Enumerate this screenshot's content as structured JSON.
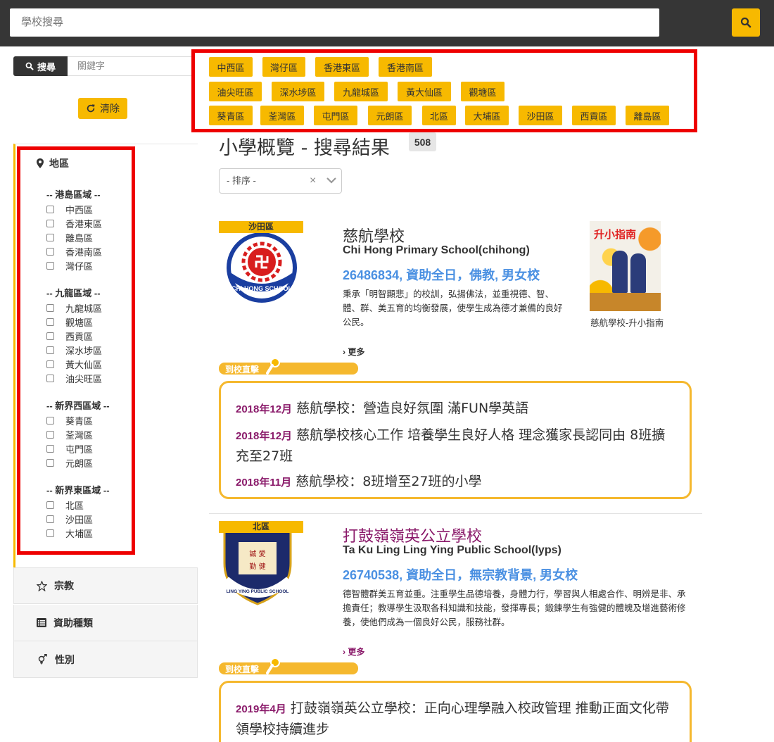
{
  "topbar": {
    "search_placeholder": "學校搜尋",
    "search_button_icon": "search-icon"
  },
  "sidebar": {
    "keyword_button": "搜尋",
    "keyword_placeholder": "關鍵字",
    "clear_button": "清除",
    "region_title": "地區",
    "groups": [
      {
        "title": "-- 港島區域 --",
        "items": [
          "中西區",
          "香港東區",
          "離島區",
          "香港南區",
          "灣仔區"
        ]
      },
      {
        "title": "-- 九龍區域 --",
        "items": [
          "九龍城區",
          "觀塘區",
          "西貢區",
          "深水埗區",
          "黃大仙區",
          "油尖旺區"
        ]
      },
      {
        "title": "-- 新界西區域 --",
        "items": [
          "葵青區",
          "荃灣區",
          "屯門區",
          "元朗區"
        ]
      },
      {
        "title": "-- 新界東區域 --",
        "items": [
          "北區",
          "沙田區",
          "大埔區"
        ]
      }
    ],
    "accordions": [
      {
        "label": "宗教",
        "icon": "star-outline-icon"
      },
      {
        "label": "資助種類",
        "icon": "list-icon"
      },
      {
        "label": "性別",
        "icon": "gender-icon"
      }
    ]
  },
  "district_tags": {
    "row1": [
      "中西區",
      "灣仔區",
      "香港東區",
      "香港南區"
    ],
    "row2": [
      "油尖旺區",
      "深水埗區",
      "九龍城區",
      "黃大仙區",
      "觀塘區"
    ],
    "row3": [
      "葵青區",
      "荃灣區",
      "屯門區",
      "元朗區",
      "北區",
      "大埔區",
      "沙田區",
      "西貢區",
      "離島區"
    ]
  },
  "results": {
    "title": "小學概覽 - 搜尋結果",
    "count": "508",
    "sort_placeholder": "- 排序 -",
    "sort_clear": "×"
  },
  "schools": [
    {
      "district": "沙田區",
      "name_zh": "慈航學校",
      "name_en": "Chi Hong Primary School(chihong)",
      "info": "26486834, 資助全日，佛教, 男女校",
      "description": "秉承「明智顯悲」的校訓，弘揚佛法，並重視德、智、體、群、美五育的均衡發展，使學生成為德才兼備的良好公民。",
      "more": "更多",
      "direct_label": "到校直擊",
      "guide_caption": "慈航學校-升小指南",
      "guide_cover_title": "升小指南",
      "logo_text": "CHI HONG SCHOOL",
      "news": [
        {
          "date": "2018年12月",
          "title": "慈航學校：營造良好氛圍 滿FUN學英語"
        },
        {
          "date": "2018年12月",
          "title": "慈航學校核心工作 培養學生良好人格 理念獲家長認同由 8班擴充至27班"
        },
        {
          "date": "2018年11月",
          "title": "慈航學校：8班增至27班的小學"
        }
      ]
    },
    {
      "district": "北區",
      "name_zh": "打鼓嶺嶺英公立學校",
      "name_en": "Ta Ku Ling Ling Ying Public School(lyps)",
      "info": "26740538, 資助全日，無宗教背景, 男女校",
      "description": "德智體群美五育並重。注重學生品德培養，身體力行，學習與人相處合作、明辨是非、承擔責任；教導學生汲取各科知識和技能，發揮專長；鍛鍊學生有強健的體魄及增進藝術修養，使他們成為一個良好公民，服務社群。",
      "more": "更多",
      "direct_label": "到校直擊",
      "logo_text": "LING YING PUBLIC SCHOOL",
      "news": [
        {
          "date": "2019年4月",
          "title": "打鼓嶺嶺英公立學校：正向心理學融入校政管理 推動正面文化帶領學校持續進步"
        }
      ]
    }
  ],
  "colors": {
    "accent": "#f7b900",
    "highlight_red": "#ee0000",
    "link_blue": "#4a90e2",
    "date_purple": "#8a1a6a",
    "dark_bar": "#363636"
  }
}
